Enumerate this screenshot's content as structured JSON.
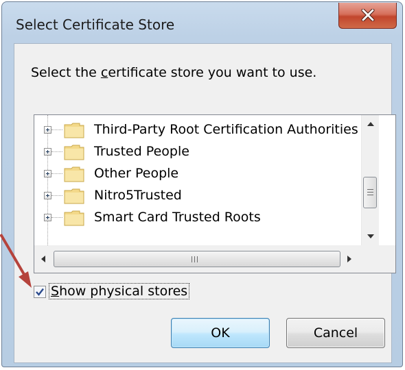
{
  "window": {
    "title": "Select Certificate Store",
    "close_icon": "close-x-icon"
  },
  "prompt": {
    "before": "Select the ",
    "underlined": "c",
    "after": "ertificate store you want to use."
  },
  "tree": {
    "items": [
      {
        "label": "Third-Party Root Certification Authorities",
        "icon": "folder-icon"
      },
      {
        "label": "Trusted People",
        "icon": "folder-icon"
      },
      {
        "label": "Other People",
        "icon": "folder-icon"
      },
      {
        "label": "Nitro5Trusted",
        "icon": "folder-icon"
      },
      {
        "label": "Smart Card Trusted Roots",
        "icon": "folder-icon"
      }
    ],
    "hscroll_grip": "III"
  },
  "show_physical": {
    "checked": true,
    "underlined": "S",
    "rest": "how physical stores"
  },
  "buttons": {
    "ok": "OK",
    "cancel": "Cancel"
  },
  "colors": {
    "annotation_arrow": "#b5433c",
    "titlebar": "#c9dbed",
    "close_button": "#c9503a",
    "ok_button_border": "#3c7fb1"
  }
}
